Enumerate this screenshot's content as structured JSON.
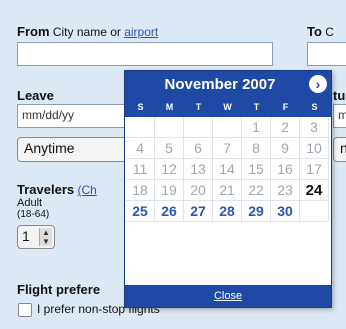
{
  "from": {
    "label": "From",
    "hint": "City name or",
    "link": "airport",
    "value": ""
  },
  "to": {
    "label": "To",
    "hint_partial": "C"
  },
  "leave": {
    "label": "Leave",
    "date_placeholder": "mm/dd/yy",
    "time_value": "Anytime"
  },
  "return_partial": {
    "label": "tu",
    "date_partial": "m/",
    "time_partial": "ny"
  },
  "travelers": {
    "label": "Travelers",
    "link_partial": "(Ch",
    "adult_label": "Adult",
    "adult_range": "(18-64)",
    "adult_count": "1"
  },
  "flight_prefs": {
    "label": "Flight prefere",
    "nonstop_label": "I prefer non-stop flights"
  },
  "calendar": {
    "title": "November 2007",
    "next_icon": "chevron-right-icon",
    "weekdays": [
      "S",
      "M",
      "T",
      "W",
      "T",
      "F",
      "S"
    ],
    "weeks": [
      [
        "",
        "",
        "",
        "",
        "1",
        "2",
        "3"
      ],
      [
        "4",
        "5",
        "6",
        "7",
        "8",
        "9",
        "10"
      ],
      [
        "11",
        "12",
        "13",
        "14",
        "15",
        "16",
        "17"
      ],
      [
        "18",
        "19",
        "20",
        "21",
        "22",
        "23",
        "24"
      ],
      [
        "25",
        "26",
        "27",
        "28",
        "29",
        "30",
        ""
      ]
    ],
    "today": "24",
    "close_label": "Close",
    "colors": {
      "header": "#1e4aa6",
      "available": "#2a56b8",
      "past": "#a0a6ae"
    }
  }
}
